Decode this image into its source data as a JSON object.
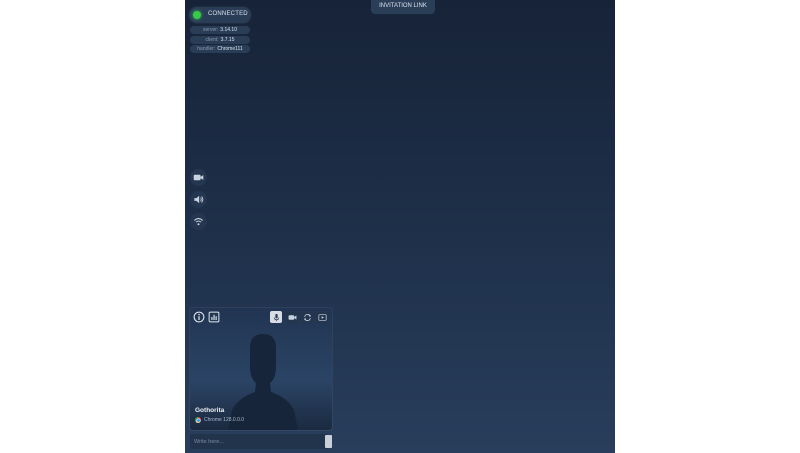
{
  "connection": {
    "status": "CONNECTED",
    "status_color": "#36c94a"
  },
  "versions": [
    {
      "label": "server:",
      "value": "3.14.10"
    },
    {
      "label": "client:",
      "value": "3.7.15"
    },
    {
      "label": "handler:",
      "value": "Chrome111"
    }
  ],
  "header": {
    "invite_label": "INVITATION LINK"
  },
  "sidebar": {
    "icons": [
      "camera-icon",
      "speaker-icon",
      "wifi-icon"
    ]
  },
  "participant": {
    "name": "Gothorita",
    "browser": "Chrome 128.0.0.0",
    "controls": [
      "microphone-icon",
      "camera-icon",
      "flip-camera-icon",
      "screen-share-icon"
    ],
    "active_control": "microphone-icon"
  },
  "chat": {
    "placeholder": "Write here..."
  },
  "colors": {
    "background_top": "#172338",
    "background_bottom": "#283e5c",
    "pill": "#2a3d57"
  }
}
